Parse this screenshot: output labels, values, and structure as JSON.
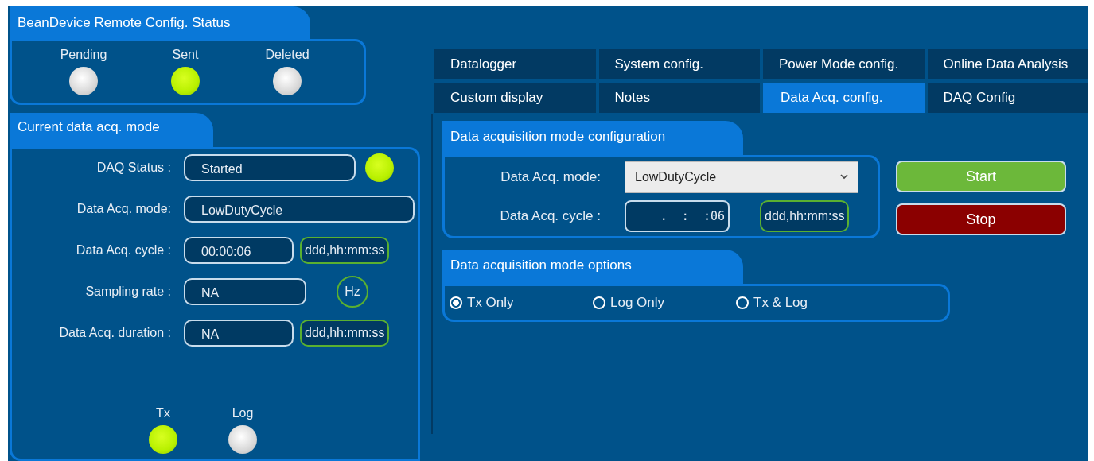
{
  "remote_config_status": {
    "title": "BeanDevice Remote Config. Status",
    "indicators": [
      {
        "label": "Pending",
        "on": false
      },
      {
        "label": "Sent",
        "on": true
      },
      {
        "label": "Deleted",
        "on": false
      }
    ]
  },
  "current_mode": {
    "title": "Current data acq. mode",
    "fields": [
      {
        "label": "DAQ Status :",
        "value": "Started",
        "kind": "led",
        "on": true
      },
      {
        "label": "Data Acq. mode:",
        "value": "LowDutyCycle",
        "kind": "wide"
      },
      {
        "label": "Data Acq. cycle :",
        "value": "00:00:06",
        "kind": "time",
        "unit": "ddd,hh:mm:ss"
      },
      {
        "label": "Sampling rate :",
        "value": "NA",
        "kind": "rate",
        "unit": "Hz"
      },
      {
        "label": "Data Acq. duration :",
        "value": "NA",
        "kind": "time",
        "unit": "ddd,hh:mm:ss"
      }
    ],
    "indicators": [
      {
        "label": "Tx",
        "on": true
      },
      {
        "label": "Log",
        "on": false
      }
    ]
  },
  "tabs": [
    {
      "label": "Datalogger",
      "selected": false
    },
    {
      "label": "System config.",
      "selected": false
    },
    {
      "label": "Power Mode config.",
      "selected": false
    },
    {
      "label": "Online Data Analysis",
      "selected": false
    },
    {
      "label": "Custom display",
      "selected": false
    },
    {
      "label": "Notes",
      "selected": false
    },
    {
      "label": "Data Acq. config.",
      "selected": true
    },
    {
      "label": "DAQ Config",
      "selected": false
    }
  ],
  "mode_config": {
    "title": "Data acquisition mode configuration",
    "mode_label": "Data Acq. mode:",
    "mode_value": "LowDutyCycle",
    "cycle_label": "Data Acq. cycle :",
    "cycle_value": "___.__:__:06",
    "cycle_unit": "ddd,hh:mm:ss"
  },
  "buttons": [
    {
      "label": "Start",
      "kind": "start"
    },
    {
      "label": "Stop",
      "kind": "stop"
    }
  ],
  "mode_options": {
    "title": "Data acquisition mode options",
    "options": [
      {
        "label": "Tx Only",
        "selected": true
      },
      {
        "label": "Log Only",
        "selected": false
      },
      {
        "label": "Tx & Log",
        "selected": false
      }
    ]
  }
}
